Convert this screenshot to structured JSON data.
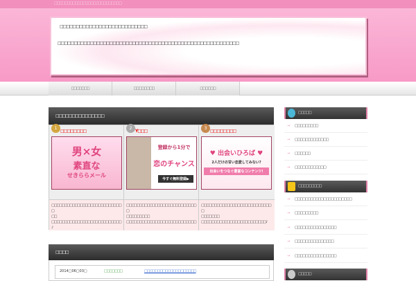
{
  "topbar": {
    "text": "□□□□□□□□□□□□□□□□□□□□□□□□□□"
  },
  "header": {
    "line1": "□□□□□□□□□□□□□□□□□□□□□□□□□□□",
    "line2": "□□□□□□□□□□□□□□□□□□□□□□□□□□□□□□□□□□□□□□□□□□□□□□□□□□□□□□□□"
  },
  "nav": [
    "□□□□□□□",
    "□□□□□□□□",
    "□□□□□□"
  ],
  "ranking": {
    "title": "□□□□□□□□□□□□□□□",
    "items": [
      {
        "rank": "1",
        "name": "□□□□□□□□",
        "banner": [
          "男×女",
          "素直な",
          "せきららメール"
        ],
        "desc": [
          "□□□□□□□□□□□□□□□□□□□□□□□□□□□□",
          "□□",
          "□□□□□□□□□□□□□□□□□□□□□□□□□□□♪"
        ]
      },
      {
        "rank": "2",
        "name": "Y□□□",
        "banner": [
          "登録から1分で",
          "恋のチャンス",
          "今すぐ無料登録▶"
        ],
        "desc": [
          "□□□□□□□□□□□□□□□□□□□□□□□□□□□□",
          "□□□□□□□□□",
          "□□□□□□□□□□□□□□□□□□□□□□□□□□□"
        ]
      },
      {
        "rank": "3",
        "name": "□□□□□□□□",
        "banner": [
          "♥ 出会いひろば ♥",
          "2人だけの甘い恋愛してみない?",
          "出会いをつなぐ豊富なコンテンツ!"
        ],
        "desc": [
          "□□□□□□□□□□□□□□□□□□□□□□□□□□□□",
          "□□□□□□□",
          "□□□□□□□□□□□□□□□□□□□□□□□□□♪"
        ]
      }
    ]
  },
  "news": {
    "title": "□□□□",
    "rows": [
      {
        "date": "2014□06□03□",
        "category": "□□□□□□□",
        "title": "□□□□□□□□□□□□□□□□□□□□"
      }
    ]
  },
  "sidebar": [
    {
      "title": "□□□□□",
      "items": [
        "□□□□□□□□□",
        "□□□□□□□□□□□□□",
        "□□□□□□",
        "□□□□□□□□□□□□"
      ]
    },
    {
      "title": "□□□□□□□□□",
      "items": [
        "□□□□□□□□□□□□□□□□□□□□□□",
        "□□□□□□□□□",
        "□□□□□□□□□□□□□□□□",
        "□□□□□□□□□□□□□□□",
        "□□□□□□□□□□□□□□□□"
      ]
    },
    {
      "title": "□□□□□",
      "items": []
    }
  ]
}
